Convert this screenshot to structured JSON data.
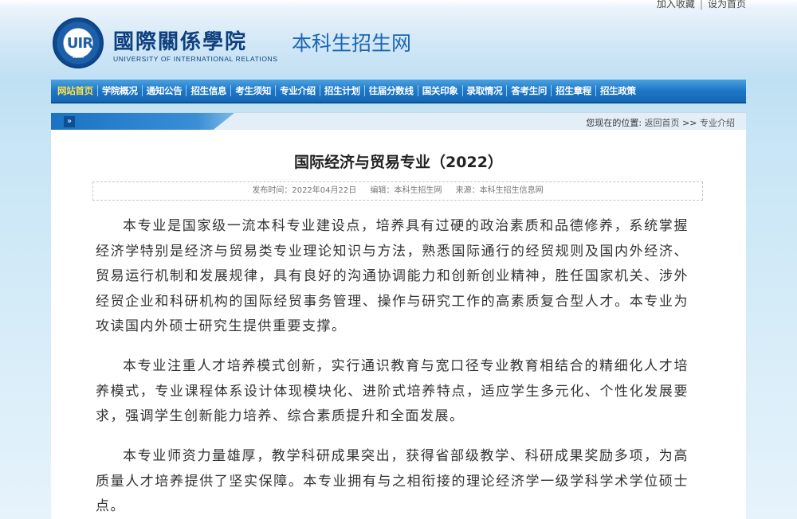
{
  "topbar": {
    "favorite": "加入收藏",
    "separator": "|",
    "homepage": "设为首页"
  },
  "header": {
    "logo_mark": "UIR",
    "logo_year": "1949",
    "school_name_cn": "國際關係學院",
    "school_name_en": "UNIVERSITY OF INTERNATIONAL RELATIONS",
    "site_title": "本科生招生网"
  },
  "nav": {
    "items": [
      {
        "label": "网站首页"
      },
      {
        "label": "学院概况"
      },
      {
        "label": "通知公告"
      },
      {
        "label": "招生信息"
      },
      {
        "label": "考生须知"
      },
      {
        "label": "专业介绍"
      },
      {
        "label": "招生计划"
      },
      {
        "label": "往届分数线"
      },
      {
        "label": "国关印象"
      },
      {
        "label": "录取情况"
      },
      {
        "label": "答考生问"
      },
      {
        "label": "招生章程"
      },
      {
        "label": "招生政策"
      }
    ],
    "active_color": "#ffe34a"
  },
  "breadcrumb": {
    "arrow_icon": "double-chevron-right-icon",
    "location_label": "您现在的位置:",
    "home_link": "返回首页",
    "separator": ">>",
    "current": "专业介绍"
  },
  "article": {
    "title": "国际经济与贸易专业（2022）",
    "publish_time": "发布时间：2022年04月22日",
    "editor": "编辑：本科生招生网",
    "source": "来源：本科生招生信息网",
    "paragraphs": [
      "本专业是国家级一流本科专业建设点，培养具有过硬的政治素质和品德修养，系统掌握经济学特别是经济与贸易类专业理论知识与方法，熟悉国际通行的经贸规则及国内外经济、贸易运行机制和发展规律，具有良好的沟通协调能力和创新创业精神，胜任国家机关、涉外经贸企业和科研机构的国际经贸事务管理、操作与研究工作的高素质复合型人才。本专业为攻读国内外硕士研究生提供重要支撑。",
      "本专业注重人才培养模式创新，实行通识教育与宽口径专业教育相结合的精细化人才培养模式，专业课程体系设计体现模块化、进阶式培养特点，适应学生多元化、个性化发展要求，强调学生创新能力培养、综合素质提升和全面发展。",
      "本专业师资力量雄厚，教学科研成果突出，获得省部级教学、科研成果奖励多项，为高质量人才培养提供了坚实保障。本专业拥有与之相衔接的理论经济学一级学科学术学位硕士点。"
    ]
  }
}
